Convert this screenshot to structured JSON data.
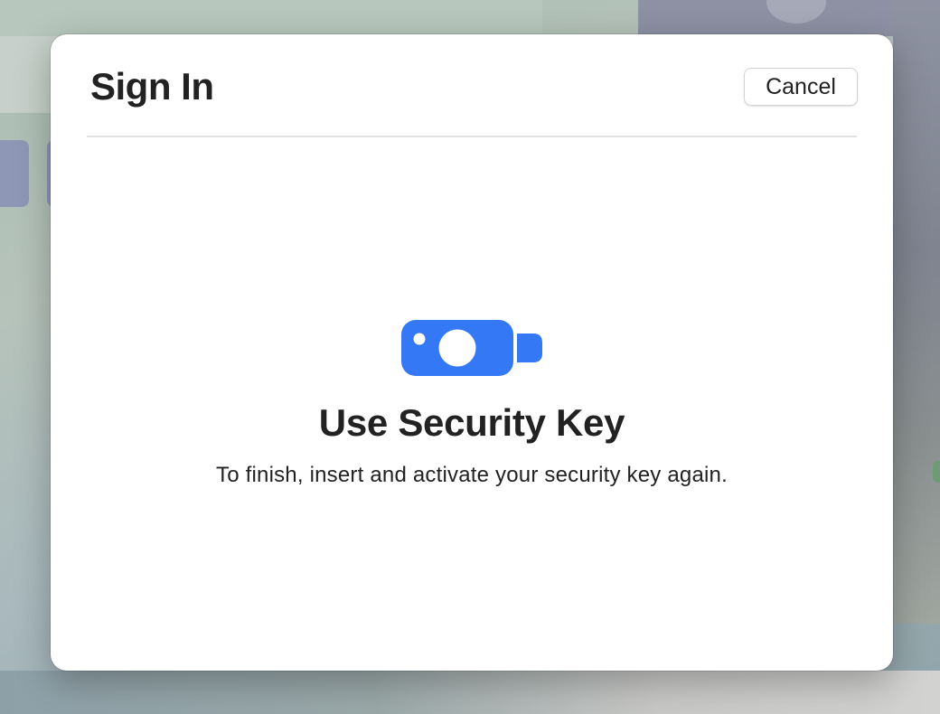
{
  "dialog": {
    "title": "Sign In",
    "cancel_label": "Cancel",
    "icon": "security-key-icon",
    "heading": "Use Security Key",
    "message": "To finish, insert and activate your security key again."
  },
  "colors": {
    "accent": "#3478f6",
    "text": "#222222",
    "dialog_background": "#ffffff"
  }
}
